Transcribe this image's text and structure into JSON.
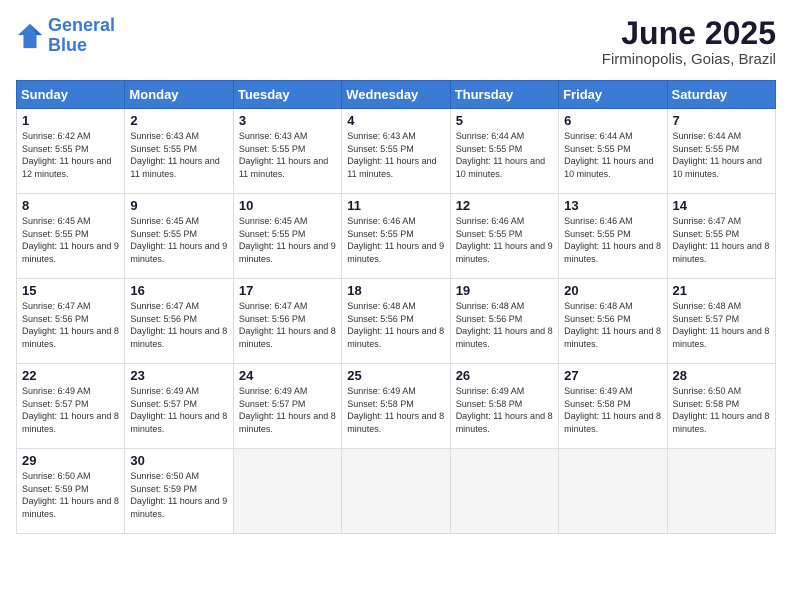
{
  "logo": {
    "line1": "General",
    "line2": "Blue"
  },
  "title": "June 2025",
  "subtitle": "Firminopolis, Goias, Brazil",
  "days_header": [
    "Sunday",
    "Monday",
    "Tuesday",
    "Wednesday",
    "Thursday",
    "Friday",
    "Saturday"
  ],
  "weeks": [
    [
      {
        "day": "1",
        "info": "Sunrise: 6:42 AM\nSunset: 5:55 PM\nDaylight: 11 hours and 12 minutes."
      },
      {
        "day": "2",
        "info": "Sunrise: 6:43 AM\nSunset: 5:55 PM\nDaylight: 11 hours and 11 minutes."
      },
      {
        "day": "3",
        "info": "Sunrise: 6:43 AM\nSunset: 5:55 PM\nDaylight: 11 hours and 11 minutes."
      },
      {
        "day": "4",
        "info": "Sunrise: 6:43 AM\nSunset: 5:55 PM\nDaylight: 11 hours and 11 minutes."
      },
      {
        "day": "5",
        "info": "Sunrise: 6:44 AM\nSunset: 5:55 PM\nDaylight: 11 hours and 10 minutes."
      },
      {
        "day": "6",
        "info": "Sunrise: 6:44 AM\nSunset: 5:55 PM\nDaylight: 11 hours and 10 minutes."
      },
      {
        "day": "7",
        "info": "Sunrise: 6:44 AM\nSunset: 5:55 PM\nDaylight: 11 hours and 10 minutes."
      }
    ],
    [
      {
        "day": "8",
        "info": "Sunrise: 6:45 AM\nSunset: 5:55 PM\nDaylight: 11 hours and 9 minutes."
      },
      {
        "day": "9",
        "info": "Sunrise: 6:45 AM\nSunset: 5:55 PM\nDaylight: 11 hours and 9 minutes."
      },
      {
        "day": "10",
        "info": "Sunrise: 6:45 AM\nSunset: 5:55 PM\nDaylight: 11 hours and 9 minutes."
      },
      {
        "day": "11",
        "info": "Sunrise: 6:46 AM\nSunset: 5:55 PM\nDaylight: 11 hours and 9 minutes."
      },
      {
        "day": "12",
        "info": "Sunrise: 6:46 AM\nSunset: 5:55 PM\nDaylight: 11 hours and 9 minutes."
      },
      {
        "day": "13",
        "info": "Sunrise: 6:46 AM\nSunset: 5:55 PM\nDaylight: 11 hours and 8 minutes."
      },
      {
        "day": "14",
        "info": "Sunrise: 6:47 AM\nSunset: 5:55 PM\nDaylight: 11 hours and 8 minutes."
      }
    ],
    [
      {
        "day": "15",
        "info": "Sunrise: 6:47 AM\nSunset: 5:56 PM\nDaylight: 11 hours and 8 minutes."
      },
      {
        "day": "16",
        "info": "Sunrise: 6:47 AM\nSunset: 5:56 PM\nDaylight: 11 hours and 8 minutes."
      },
      {
        "day": "17",
        "info": "Sunrise: 6:47 AM\nSunset: 5:56 PM\nDaylight: 11 hours and 8 minutes."
      },
      {
        "day": "18",
        "info": "Sunrise: 6:48 AM\nSunset: 5:56 PM\nDaylight: 11 hours and 8 minutes."
      },
      {
        "day": "19",
        "info": "Sunrise: 6:48 AM\nSunset: 5:56 PM\nDaylight: 11 hours and 8 minutes."
      },
      {
        "day": "20",
        "info": "Sunrise: 6:48 AM\nSunset: 5:56 PM\nDaylight: 11 hours and 8 minutes."
      },
      {
        "day": "21",
        "info": "Sunrise: 6:48 AM\nSunset: 5:57 PM\nDaylight: 11 hours and 8 minutes."
      }
    ],
    [
      {
        "day": "22",
        "info": "Sunrise: 6:49 AM\nSunset: 5:57 PM\nDaylight: 11 hours and 8 minutes."
      },
      {
        "day": "23",
        "info": "Sunrise: 6:49 AM\nSunset: 5:57 PM\nDaylight: 11 hours and 8 minutes."
      },
      {
        "day": "24",
        "info": "Sunrise: 6:49 AM\nSunset: 5:57 PM\nDaylight: 11 hours and 8 minutes."
      },
      {
        "day": "25",
        "info": "Sunrise: 6:49 AM\nSunset: 5:58 PM\nDaylight: 11 hours and 8 minutes."
      },
      {
        "day": "26",
        "info": "Sunrise: 6:49 AM\nSunset: 5:58 PM\nDaylight: 11 hours and 8 minutes."
      },
      {
        "day": "27",
        "info": "Sunrise: 6:49 AM\nSunset: 5:58 PM\nDaylight: 11 hours and 8 minutes."
      },
      {
        "day": "28",
        "info": "Sunrise: 6:50 AM\nSunset: 5:58 PM\nDaylight: 11 hours and 8 minutes."
      }
    ],
    [
      {
        "day": "29",
        "info": "Sunrise: 6:50 AM\nSunset: 5:59 PM\nDaylight: 11 hours and 8 minutes."
      },
      {
        "day": "30",
        "info": "Sunrise: 6:50 AM\nSunset: 5:59 PM\nDaylight: 11 hours and 9 minutes."
      },
      {
        "day": "",
        "info": ""
      },
      {
        "day": "",
        "info": ""
      },
      {
        "day": "",
        "info": ""
      },
      {
        "day": "",
        "info": ""
      },
      {
        "day": "",
        "info": ""
      }
    ]
  ]
}
